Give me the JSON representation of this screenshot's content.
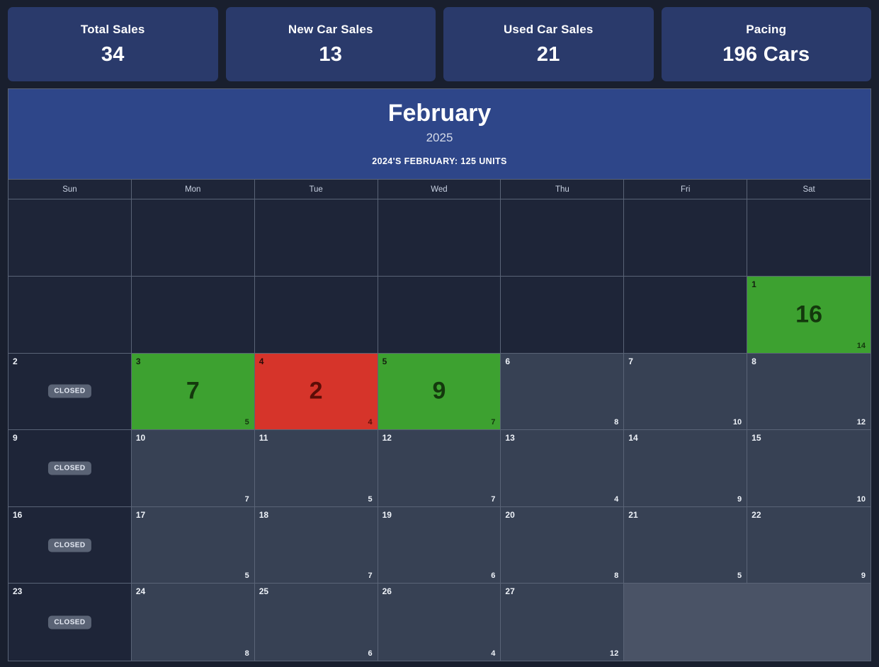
{
  "theme": {
    "page_bg": "#191f2e",
    "kpi_card_bg": "#2a3a6b",
    "calendar_header_bg": "#2e4689",
    "day_cell_bg": "#374154",
    "closed_cell_bg": "#1e2538",
    "green": "#3da130",
    "red": "#d6342a",
    "trailing_bg": "#4a5366",
    "border": "#5a6477"
  },
  "kpis": [
    {
      "label": "Total Sales",
      "value": "34"
    },
    {
      "label": "New Car Sales",
      "value": "13"
    },
    {
      "label": "Used Car Sales",
      "value": "21"
    },
    {
      "label": "Pacing",
      "value": "196 Cars"
    }
  ],
  "calendar": {
    "month": "February",
    "year": "2025",
    "note": "2024'S FEBRUARY: 125 UNITS",
    "closed_badge_label": "CLOSED",
    "weekdays": [
      "Sun",
      "Mon",
      "Tue",
      "Wed",
      "Thu",
      "Fri",
      "Sat"
    ],
    "weeks": [
      [
        {
          "type": "empty"
        },
        {
          "type": "empty"
        },
        {
          "type": "empty"
        },
        {
          "type": "empty"
        },
        {
          "type": "empty"
        },
        {
          "type": "empty"
        },
        {
          "type": "empty"
        }
      ],
      [
        {
          "type": "empty"
        },
        {
          "type": "empty"
        },
        {
          "type": "empty"
        },
        {
          "type": "empty"
        },
        {
          "type": "empty"
        },
        {
          "type": "empty"
        },
        {
          "type": "green",
          "day": "1",
          "big": "16",
          "corner": "14"
        }
      ],
      [
        {
          "type": "closed",
          "day": "2"
        },
        {
          "type": "green",
          "day": "3",
          "big": "7",
          "corner": "5"
        },
        {
          "type": "red",
          "day": "4",
          "big": "2",
          "corner": "4"
        },
        {
          "type": "green",
          "day": "5",
          "big": "9",
          "corner": "7"
        },
        {
          "type": "normal",
          "day": "6",
          "corner": "8"
        },
        {
          "type": "normal",
          "day": "7",
          "corner": "10"
        },
        {
          "type": "normal",
          "day": "8",
          "corner": "12"
        }
      ],
      [
        {
          "type": "closed",
          "day": "9"
        },
        {
          "type": "normal",
          "day": "10",
          "corner": "7"
        },
        {
          "type": "normal",
          "day": "11",
          "corner": "5"
        },
        {
          "type": "normal",
          "day": "12",
          "corner": "7"
        },
        {
          "type": "normal",
          "day": "13",
          "corner": "4"
        },
        {
          "type": "normal",
          "day": "14",
          "corner": "9"
        },
        {
          "type": "normal",
          "day": "15",
          "corner": "10"
        }
      ],
      [
        {
          "type": "closed",
          "day": "16"
        },
        {
          "type": "normal",
          "day": "17",
          "corner": "5"
        },
        {
          "type": "normal",
          "day": "18",
          "corner": "7"
        },
        {
          "type": "normal",
          "day": "19",
          "corner": "6"
        },
        {
          "type": "normal",
          "day": "20",
          "corner": "8"
        },
        {
          "type": "normal",
          "day": "21",
          "corner": "5"
        },
        {
          "type": "normal",
          "day": "22",
          "corner": "9"
        }
      ],
      [
        {
          "type": "closed",
          "day": "23"
        },
        {
          "type": "normal",
          "day": "24",
          "corner": "8"
        },
        {
          "type": "normal",
          "day": "25",
          "corner": "6"
        },
        {
          "type": "normal",
          "day": "26",
          "corner": "4"
        },
        {
          "type": "normal",
          "day": "27",
          "corner": "12"
        },
        {
          "type": "trail"
        },
        {
          "type": "trail"
        }
      ]
    ]
  }
}
